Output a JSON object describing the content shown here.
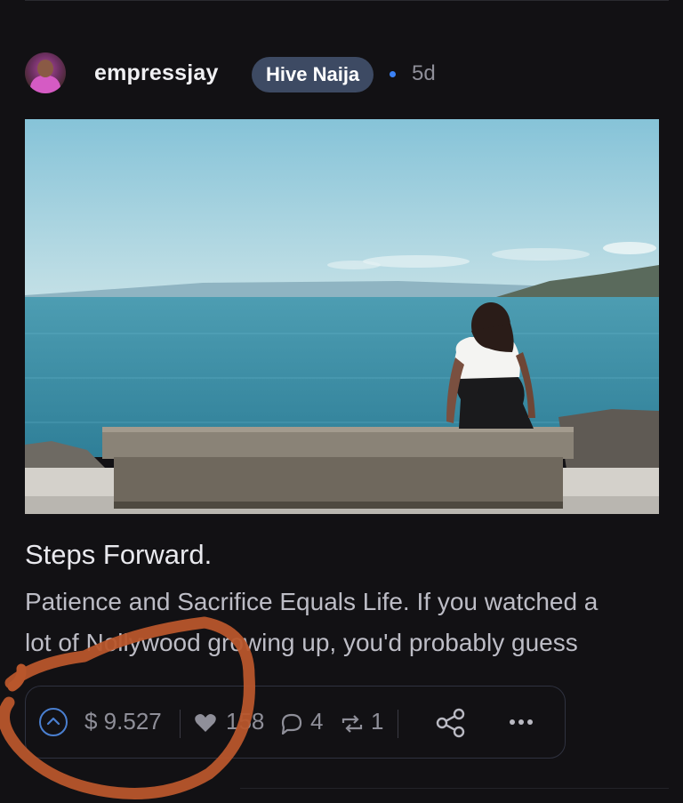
{
  "post": {
    "author": "empressjay",
    "community": "Hive Naija",
    "age": "5d",
    "title": "Steps Forward.",
    "excerpt_lines": [
      "Patience and Sacrifice Equals Life. If you watched a",
      "lot of Nollywood growing up, you'd probably guess"
    ]
  },
  "actions": {
    "payout": "$ 9.527",
    "likes": "158",
    "comments": "4",
    "reblogs": "1"
  },
  "icons": {
    "upvote": "chevron-up-circle-icon",
    "like": "heart-icon",
    "comment": "speech-bubble-icon",
    "reblog": "repeat-icon",
    "share": "share-icon",
    "more": "ellipsis-icon"
  },
  "colors": {
    "background": "#121114",
    "badge": "#3d4a63",
    "accent": "#3b82f6",
    "annotation": "#b8562b"
  }
}
